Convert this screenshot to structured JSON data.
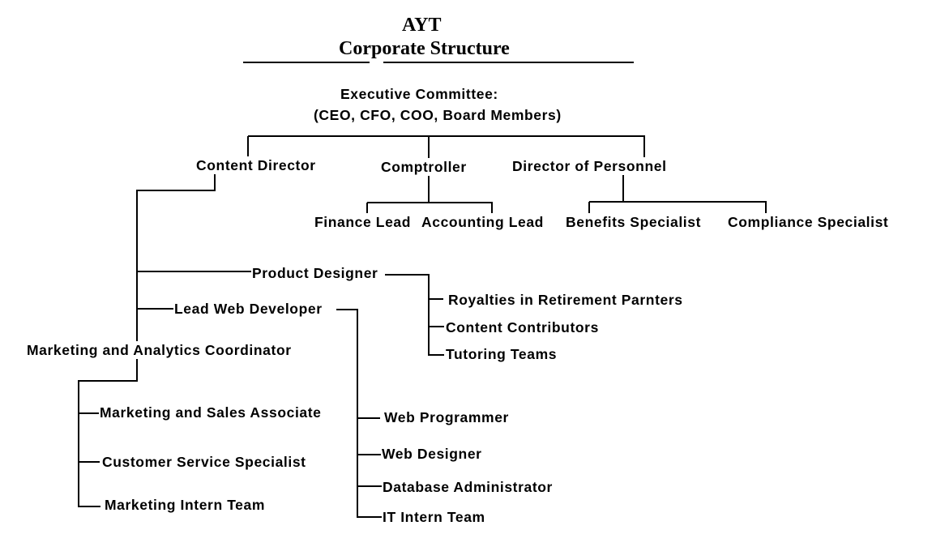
{
  "header": {
    "company": "AYT",
    "subtitle": "Corporate Structure"
  },
  "executive": {
    "title": "Executive Committee:",
    "members": "(CEO, CFO, COO, Board Members)"
  },
  "directors": {
    "content_director": "Content Director",
    "comptroller": "Comptroller",
    "director_of_personnel": "Director of Personnel"
  },
  "comptroller_reports": {
    "finance_lead": "Finance Lead",
    "accounting_lead": "Accounting Lead"
  },
  "personnel_reports": {
    "benefits_specialist": "Benefits Specialist",
    "compliance_specialist": "Compliance Specialist"
  },
  "content_reports": {
    "product_designer": "Product Designer",
    "lead_web_developer": "Lead Web Developer",
    "marketing_analytics_coordinator": "Marketing and Analytics Coordinator"
  },
  "product_designer_reports": {
    "royalties_partners": "Royalties in Retirement Parnters",
    "content_contributors": "Content Contributors",
    "tutoring_teams": "Tutoring Teams"
  },
  "web_developer_reports": {
    "web_programmer": "Web Programmer",
    "web_designer": "Web Designer",
    "database_administrator": "Database Administrator",
    "it_intern_team": "IT Intern Team"
  },
  "marketing_reports": {
    "marketing_sales_associate": "Marketing and Sales Associate",
    "customer_service_specialist": "Customer Service Specialist",
    "marketing_intern_team": "Marketing Intern Team"
  },
  "colors": {
    "line": "#000000",
    "text": "#000000",
    "background": "#ffffff"
  }
}
